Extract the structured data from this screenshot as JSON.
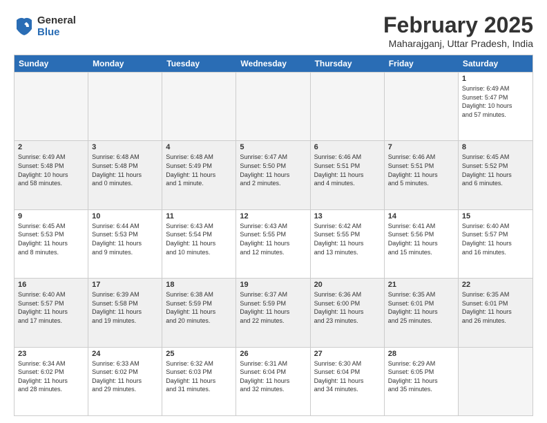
{
  "logo": {
    "general": "General",
    "blue": "Blue"
  },
  "title": "February 2025",
  "subtitle": "Maharajganj, Uttar Pradesh, India",
  "days_of_week": [
    "Sunday",
    "Monday",
    "Tuesday",
    "Wednesday",
    "Thursday",
    "Friday",
    "Saturday"
  ],
  "rows": [
    {
      "shade": false,
      "cells": [
        {
          "day": "",
          "info": ""
        },
        {
          "day": "",
          "info": ""
        },
        {
          "day": "",
          "info": ""
        },
        {
          "day": "",
          "info": ""
        },
        {
          "day": "",
          "info": ""
        },
        {
          "day": "",
          "info": ""
        },
        {
          "day": "1",
          "info": "Sunrise: 6:49 AM\nSunset: 5:47 PM\nDaylight: 10 hours\nand 57 minutes."
        }
      ]
    },
    {
      "shade": true,
      "cells": [
        {
          "day": "2",
          "info": "Sunrise: 6:49 AM\nSunset: 5:48 PM\nDaylight: 10 hours\nand 58 minutes."
        },
        {
          "day": "3",
          "info": "Sunrise: 6:48 AM\nSunset: 5:48 PM\nDaylight: 11 hours\nand 0 minutes."
        },
        {
          "day": "4",
          "info": "Sunrise: 6:48 AM\nSunset: 5:49 PM\nDaylight: 11 hours\nand 1 minute."
        },
        {
          "day": "5",
          "info": "Sunrise: 6:47 AM\nSunset: 5:50 PM\nDaylight: 11 hours\nand 2 minutes."
        },
        {
          "day": "6",
          "info": "Sunrise: 6:46 AM\nSunset: 5:51 PM\nDaylight: 11 hours\nand 4 minutes."
        },
        {
          "day": "7",
          "info": "Sunrise: 6:46 AM\nSunset: 5:51 PM\nDaylight: 11 hours\nand 5 minutes."
        },
        {
          "day": "8",
          "info": "Sunrise: 6:45 AM\nSunset: 5:52 PM\nDaylight: 11 hours\nand 6 minutes."
        }
      ]
    },
    {
      "shade": false,
      "cells": [
        {
          "day": "9",
          "info": "Sunrise: 6:45 AM\nSunset: 5:53 PM\nDaylight: 11 hours\nand 8 minutes."
        },
        {
          "day": "10",
          "info": "Sunrise: 6:44 AM\nSunset: 5:53 PM\nDaylight: 11 hours\nand 9 minutes."
        },
        {
          "day": "11",
          "info": "Sunrise: 6:43 AM\nSunset: 5:54 PM\nDaylight: 11 hours\nand 10 minutes."
        },
        {
          "day": "12",
          "info": "Sunrise: 6:43 AM\nSunset: 5:55 PM\nDaylight: 11 hours\nand 12 minutes."
        },
        {
          "day": "13",
          "info": "Sunrise: 6:42 AM\nSunset: 5:55 PM\nDaylight: 11 hours\nand 13 minutes."
        },
        {
          "day": "14",
          "info": "Sunrise: 6:41 AM\nSunset: 5:56 PM\nDaylight: 11 hours\nand 15 minutes."
        },
        {
          "day": "15",
          "info": "Sunrise: 6:40 AM\nSunset: 5:57 PM\nDaylight: 11 hours\nand 16 minutes."
        }
      ]
    },
    {
      "shade": true,
      "cells": [
        {
          "day": "16",
          "info": "Sunrise: 6:40 AM\nSunset: 5:57 PM\nDaylight: 11 hours\nand 17 minutes."
        },
        {
          "day": "17",
          "info": "Sunrise: 6:39 AM\nSunset: 5:58 PM\nDaylight: 11 hours\nand 19 minutes."
        },
        {
          "day": "18",
          "info": "Sunrise: 6:38 AM\nSunset: 5:59 PM\nDaylight: 11 hours\nand 20 minutes."
        },
        {
          "day": "19",
          "info": "Sunrise: 6:37 AM\nSunset: 5:59 PM\nDaylight: 11 hours\nand 22 minutes."
        },
        {
          "day": "20",
          "info": "Sunrise: 6:36 AM\nSunset: 6:00 PM\nDaylight: 11 hours\nand 23 minutes."
        },
        {
          "day": "21",
          "info": "Sunrise: 6:35 AM\nSunset: 6:01 PM\nDaylight: 11 hours\nand 25 minutes."
        },
        {
          "day": "22",
          "info": "Sunrise: 6:35 AM\nSunset: 6:01 PM\nDaylight: 11 hours\nand 26 minutes."
        }
      ]
    },
    {
      "shade": false,
      "cells": [
        {
          "day": "23",
          "info": "Sunrise: 6:34 AM\nSunset: 6:02 PM\nDaylight: 11 hours\nand 28 minutes."
        },
        {
          "day": "24",
          "info": "Sunrise: 6:33 AM\nSunset: 6:02 PM\nDaylight: 11 hours\nand 29 minutes."
        },
        {
          "day": "25",
          "info": "Sunrise: 6:32 AM\nSunset: 6:03 PM\nDaylight: 11 hours\nand 31 minutes."
        },
        {
          "day": "26",
          "info": "Sunrise: 6:31 AM\nSunset: 6:04 PM\nDaylight: 11 hours\nand 32 minutes."
        },
        {
          "day": "27",
          "info": "Sunrise: 6:30 AM\nSunset: 6:04 PM\nDaylight: 11 hours\nand 34 minutes."
        },
        {
          "day": "28",
          "info": "Sunrise: 6:29 AM\nSunset: 6:05 PM\nDaylight: 11 hours\nand 35 minutes."
        },
        {
          "day": "",
          "info": ""
        }
      ]
    }
  ]
}
